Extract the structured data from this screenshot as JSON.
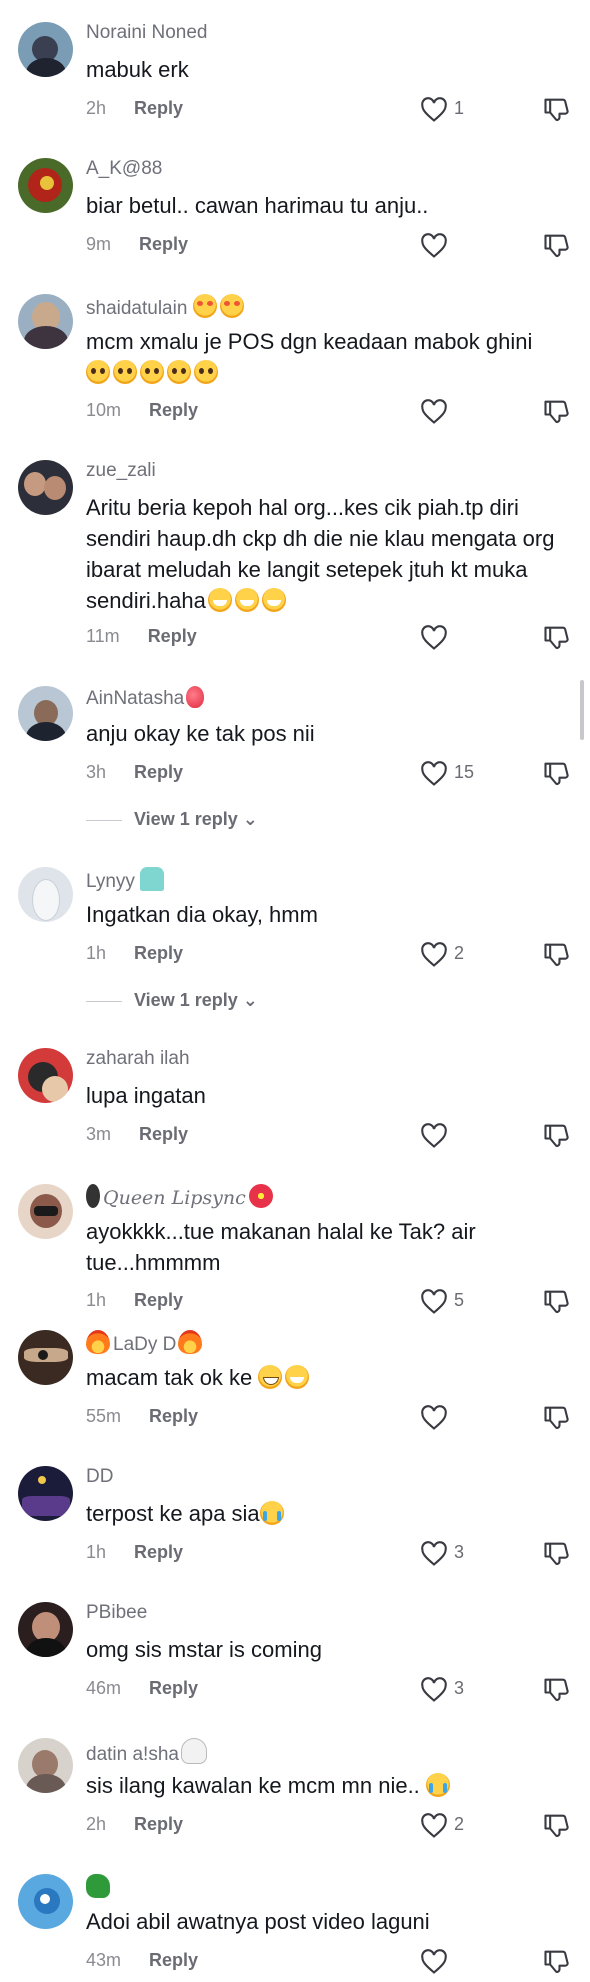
{
  "colors": {
    "text": "#16181f",
    "muted": "#6f7079",
    "meta": "#8a8b91",
    "background": "#ffffff"
  },
  "icons": {
    "like": "heart-outline-icon",
    "dislike": "thumbs-down-icon"
  },
  "comments": [
    {
      "username": "Noraini Noned",
      "text": "mabuk erk",
      "time": "2h",
      "reply": "Reply",
      "likes": "1"
    },
    {
      "username": "A_K@88",
      "text": "biar betul.. cawan harimau tu anju..",
      "time": "9m",
      "reply": "Reply",
      "likes": ""
    },
    {
      "username": "shaidatulain",
      "text": "mcm xmalu je POS dgn keadaan mabok ghini",
      "time": "10m",
      "reply": "Reply",
      "likes": ""
    },
    {
      "username": "zue_zali",
      "text": "Aritu beria kepoh hal org...kes cik piah.tp diri sendiri haup.dh ckp dh die nie klau mengata org ibarat meludah ke langit setepek jtuh kt muka sendiri.haha",
      "time": "11m",
      "reply": "Reply",
      "likes": ""
    },
    {
      "username": "AinNatasha",
      "text": "anju okay ke tak pos nii",
      "time": "3h",
      "reply": "Reply",
      "likes": "15",
      "view_replies": "View 1 reply"
    },
    {
      "username": "Lynyy",
      "text": "Ingatkan dia okay, hmm",
      "time": "1h",
      "reply": "Reply",
      "likes": "2",
      "view_replies": "View 1 reply"
    },
    {
      "username": "zaharah ilah",
      "text": "lupa ingatan",
      "time": "3m",
      "reply": "Reply",
      "likes": ""
    },
    {
      "username": "Queen Lipsync",
      "text": "ayokkkk...tue makanan halal ke Tak? air tue...hmmmm",
      "time": "1h",
      "reply": "Reply",
      "likes": "5"
    },
    {
      "username": "LaDy D",
      "text": "macam tak ok ke",
      "time": "55m",
      "reply": "Reply",
      "likes": ""
    },
    {
      "username": "DD",
      "text": "terpost ke apa sia",
      "time": "1h",
      "reply": "Reply",
      "likes": "3"
    },
    {
      "username": "PBibee",
      "text": "omg sis mstar is coming",
      "time": "46m",
      "reply": "Reply",
      "likes": "3"
    },
    {
      "username": "datin a!sha",
      "text": "sis ilang kawalan ke mcm mn nie..",
      "time": "2h",
      "reply": "Reply",
      "likes": "2"
    },
    {
      "username": "",
      "text": "Adoi abil awatnya post video laguni",
      "time": "43m",
      "reply": "Reply",
      "likes": ""
    }
  ]
}
